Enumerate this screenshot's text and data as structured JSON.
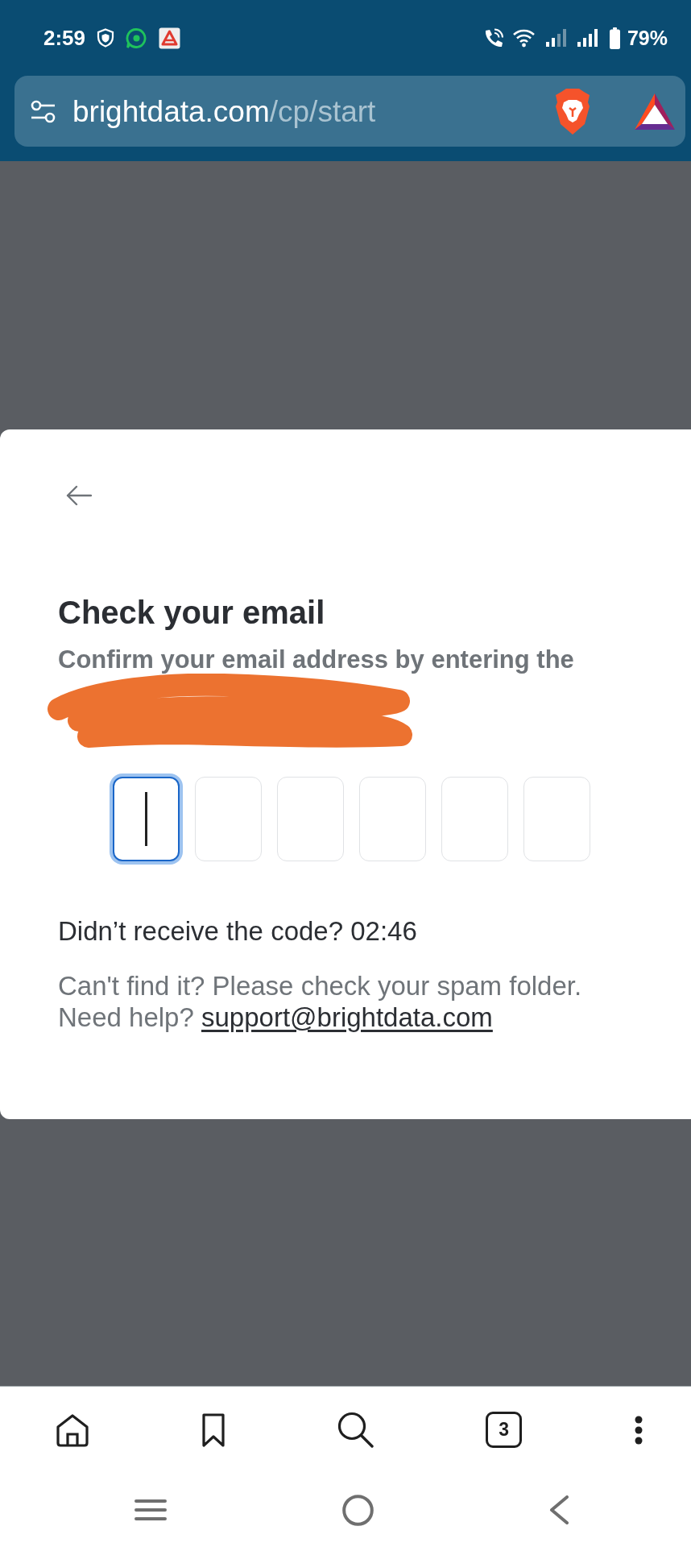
{
  "status_bar": {
    "time": "2:59",
    "battery_percent": "79%"
  },
  "address_bar": {
    "url_domain": "brightdata.com",
    "url_path": "/cp/start"
  },
  "dialog": {
    "title": "Check your email",
    "subtitle": "Confirm your email address by entering the",
    "code_boxes": [
      {
        "focused": true
      },
      {
        "focused": false
      },
      {
        "focused": false
      },
      {
        "focused": false
      },
      {
        "focused": false
      },
      {
        "focused": false
      }
    ],
    "resend_text": "Didn’t receive the code? 02:46",
    "help_text": "Can't find it? Please check your spam folder.",
    "help_prompt": "Need help?",
    "support_email": "support@brightdata.com"
  },
  "bottom_toolbar": {
    "tab_count": "3"
  }
}
